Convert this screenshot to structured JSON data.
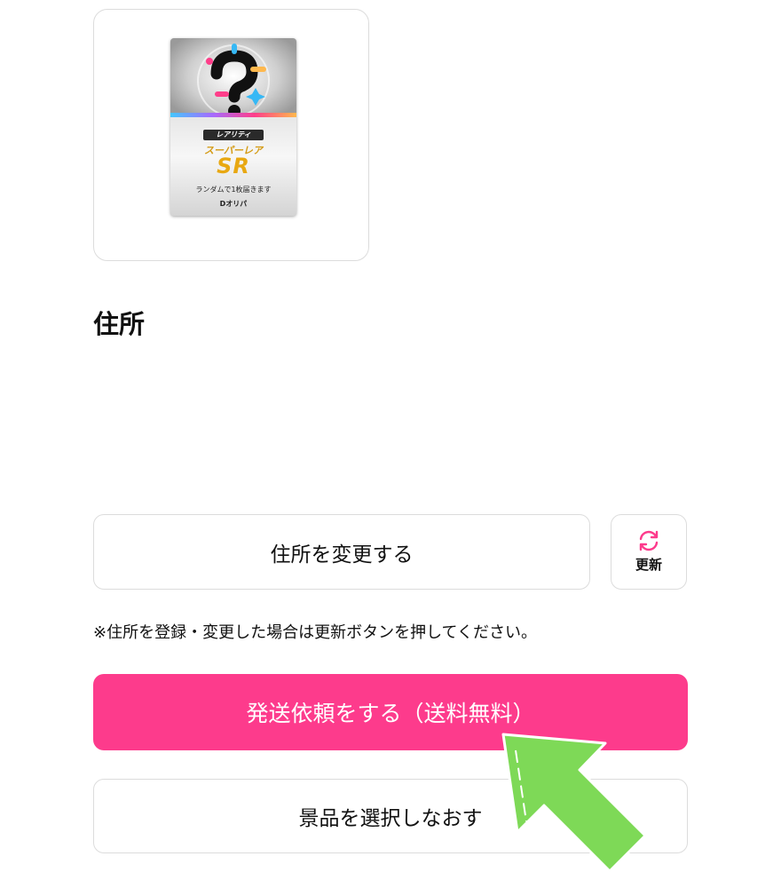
{
  "prize_card": {
    "rarity_tag": "レアリティ",
    "rarity_name": "スーパーレア",
    "rarity_code": "SR",
    "note": "ランダムで1枚届きます",
    "logo": "Dオリパ"
  },
  "address_section": {
    "title": "住所",
    "change_button_label": "住所を変更する",
    "refresh_button_label": "更新",
    "notice": "※住所を登録・変更した場合は更新ボタンを押してください。"
  },
  "actions": {
    "request_shipping_label": "発送依頼をする（送料無料）",
    "reselect_label": "景品を選択しなおす"
  },
  "colors": {
    "primary": "#fd3b8c",
    "border": "#dcdcdc",
    "arrow": "#7ed957"
  }
}
